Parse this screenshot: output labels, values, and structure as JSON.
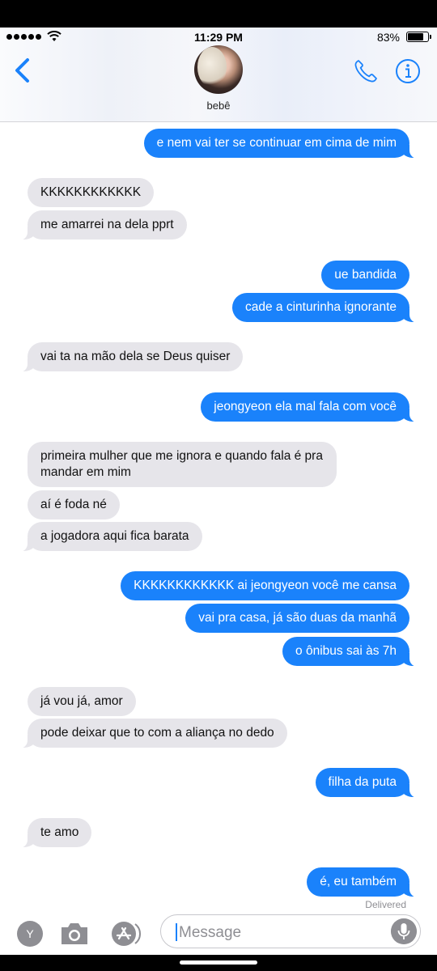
{
  "status": {
    "time": "11:29 PM",
    "battery": "83%"
  },
  "header": {
    "contact_name": "bebê"
  },
  "messages": [
    {
      "dir": "out",
      "text": "e nem vai ter se continuar em cima de mim"
    },
    {
      "dir": "in",
      "text": "KKKKKKKKKKKK"
    },
    {
      "dir": "in",
      "text": "me amarrei na dela pprt"
    },
    {
      "dir": "out",
      "text": "ue bandida"
    },
    {
      "dir": "out",
      "text": "cade a cinturinha ignorante"
    },
    {
      "dir": "in",
      "text": "vai ta na mão dela se Deus quiser"
    },
    {
      "dir": "out",
      "text": "jeongyeon ela mal fala com você"
    },
    {
      "dir": "in",
      "text": "primeira mulher que me ignora e quando fala é pra mandar em mim"
    },
    {
      "dir": "in",
      "text": "aí é foda né"
    },
    {
      "dir": "in",
      "text": "a jogadora aqui fica barata"
    },
    {
      "dir": "out",
      "text": "KKKKKKKKKKKK ai jeongyeon você me cansa"
    },
    {
      "dir": "out",
      "text": "vai pra casa, já são duas da manhã"
    },
    {
      "dir": "out",
      "text": "o ônibus sai às 7h"
    },
    {
      "dir": "in",
      "text": "já vou já, amor"
    },
    {
      "dir": "in",
      "text": "pode deixar que to com a aliança no dedo"
    },
    {
      "dir": "out",
      "text": "filha da puta"
    },
    {
      "dir": "in",
      "text": "te amo"
    },
    {
      "dir": "out",
      "text": "é, eu também"
    }
  ],
  "delivered": "Delivered",
  "input": {
    "app_letter": "Y",
    "placeholder": "Message"
  },
  "colors": {
    "outgoing": "#1a82fb",
    "incoming": "#e6e5ea",
    "accent": "#1a82fb"
  },
  "icons": [
    "back-chevron-icon",
    "phone-icon",
    "info-icon",
    "camera-icon",
    "app-store-icon",
    "microphone-icon",
    "wifi-icon",
    "battery-icon",
    "signal-icon"
  ]
}
